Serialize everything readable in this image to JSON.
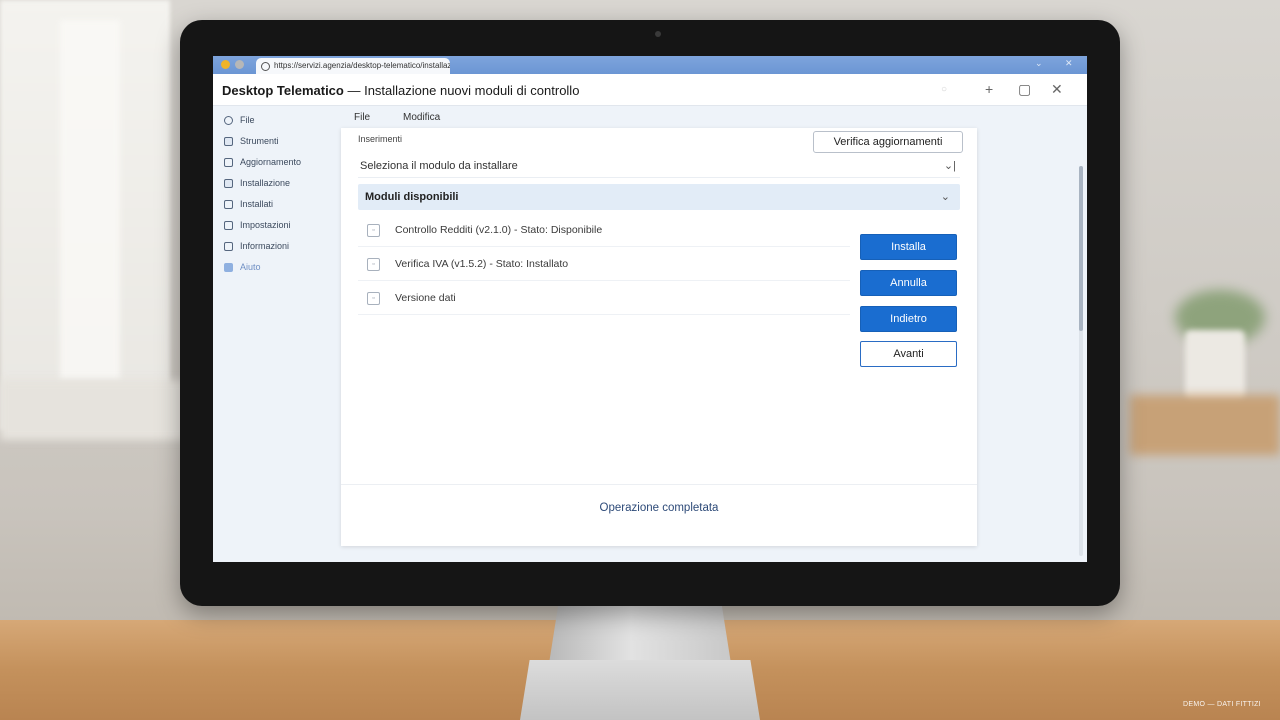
{
  "window": {
    "tab_label": "https://servizi.agenzia/desktop-telematico/installazione",
    "title_bold": "Desktop Telematico",
    "title_rest": " — Installazione nuovi moduli di controllo"
  },
  "sidebar": {
    "items": [
      {
        "label": "File",
        "icon": "circle-icon"
      },
      {
        "label": "Strumenti",
        "icon": "tools-icon"
      },
      {
        "label": "Aggiornamento",
        "icon": "update-icon"
      },
      {
        "label": "Installazione",
        "icon": "install-icon"
      },
      {
        "label": "Installati",
        "icon": "installed-icon"
      },
      {
        "label": "Impostazioni",
        "icon": "settings-icon"
      },
      {
        "label": "Informazioni",
        "icon": "info-icon"
      },
      {
        "label": "Aiuto",
        "icon": "help-icon"
      }
    ]
  },
  "menubar": {
    "items": [
      "File",
      "Modifica"
    ]
  },
  "panel": {
    "breadcrumb": "Inserimenti",
    "check_updates_label": "Verifica aggiornamenti",
    "select_placeholder": "Seleziona il modulo da installare",
    "section_title": "Moduli disponibili",
    "modules": [
      "Controllo Redditi (v2.1.0) - Stato: Disponibile",
      "Verifica IVA (v1.5.2) - Stato: Installato",
      "Versione dati"
    ],
    "buttons": {
      "install": "Installa",
      "cancel": "Annulla",
      "back": "Indietro",
      "next": "Avanti"
    },
    "status": "Operazione completata"
  },
  "watermark": "DEMO — DATI FITTIZI",
  "colors": {
    "accent": "#1a6dd0",
    "titlebar_strip": "#6b96d4",
    "section_bg": "#e2ecf7"
  }
}
